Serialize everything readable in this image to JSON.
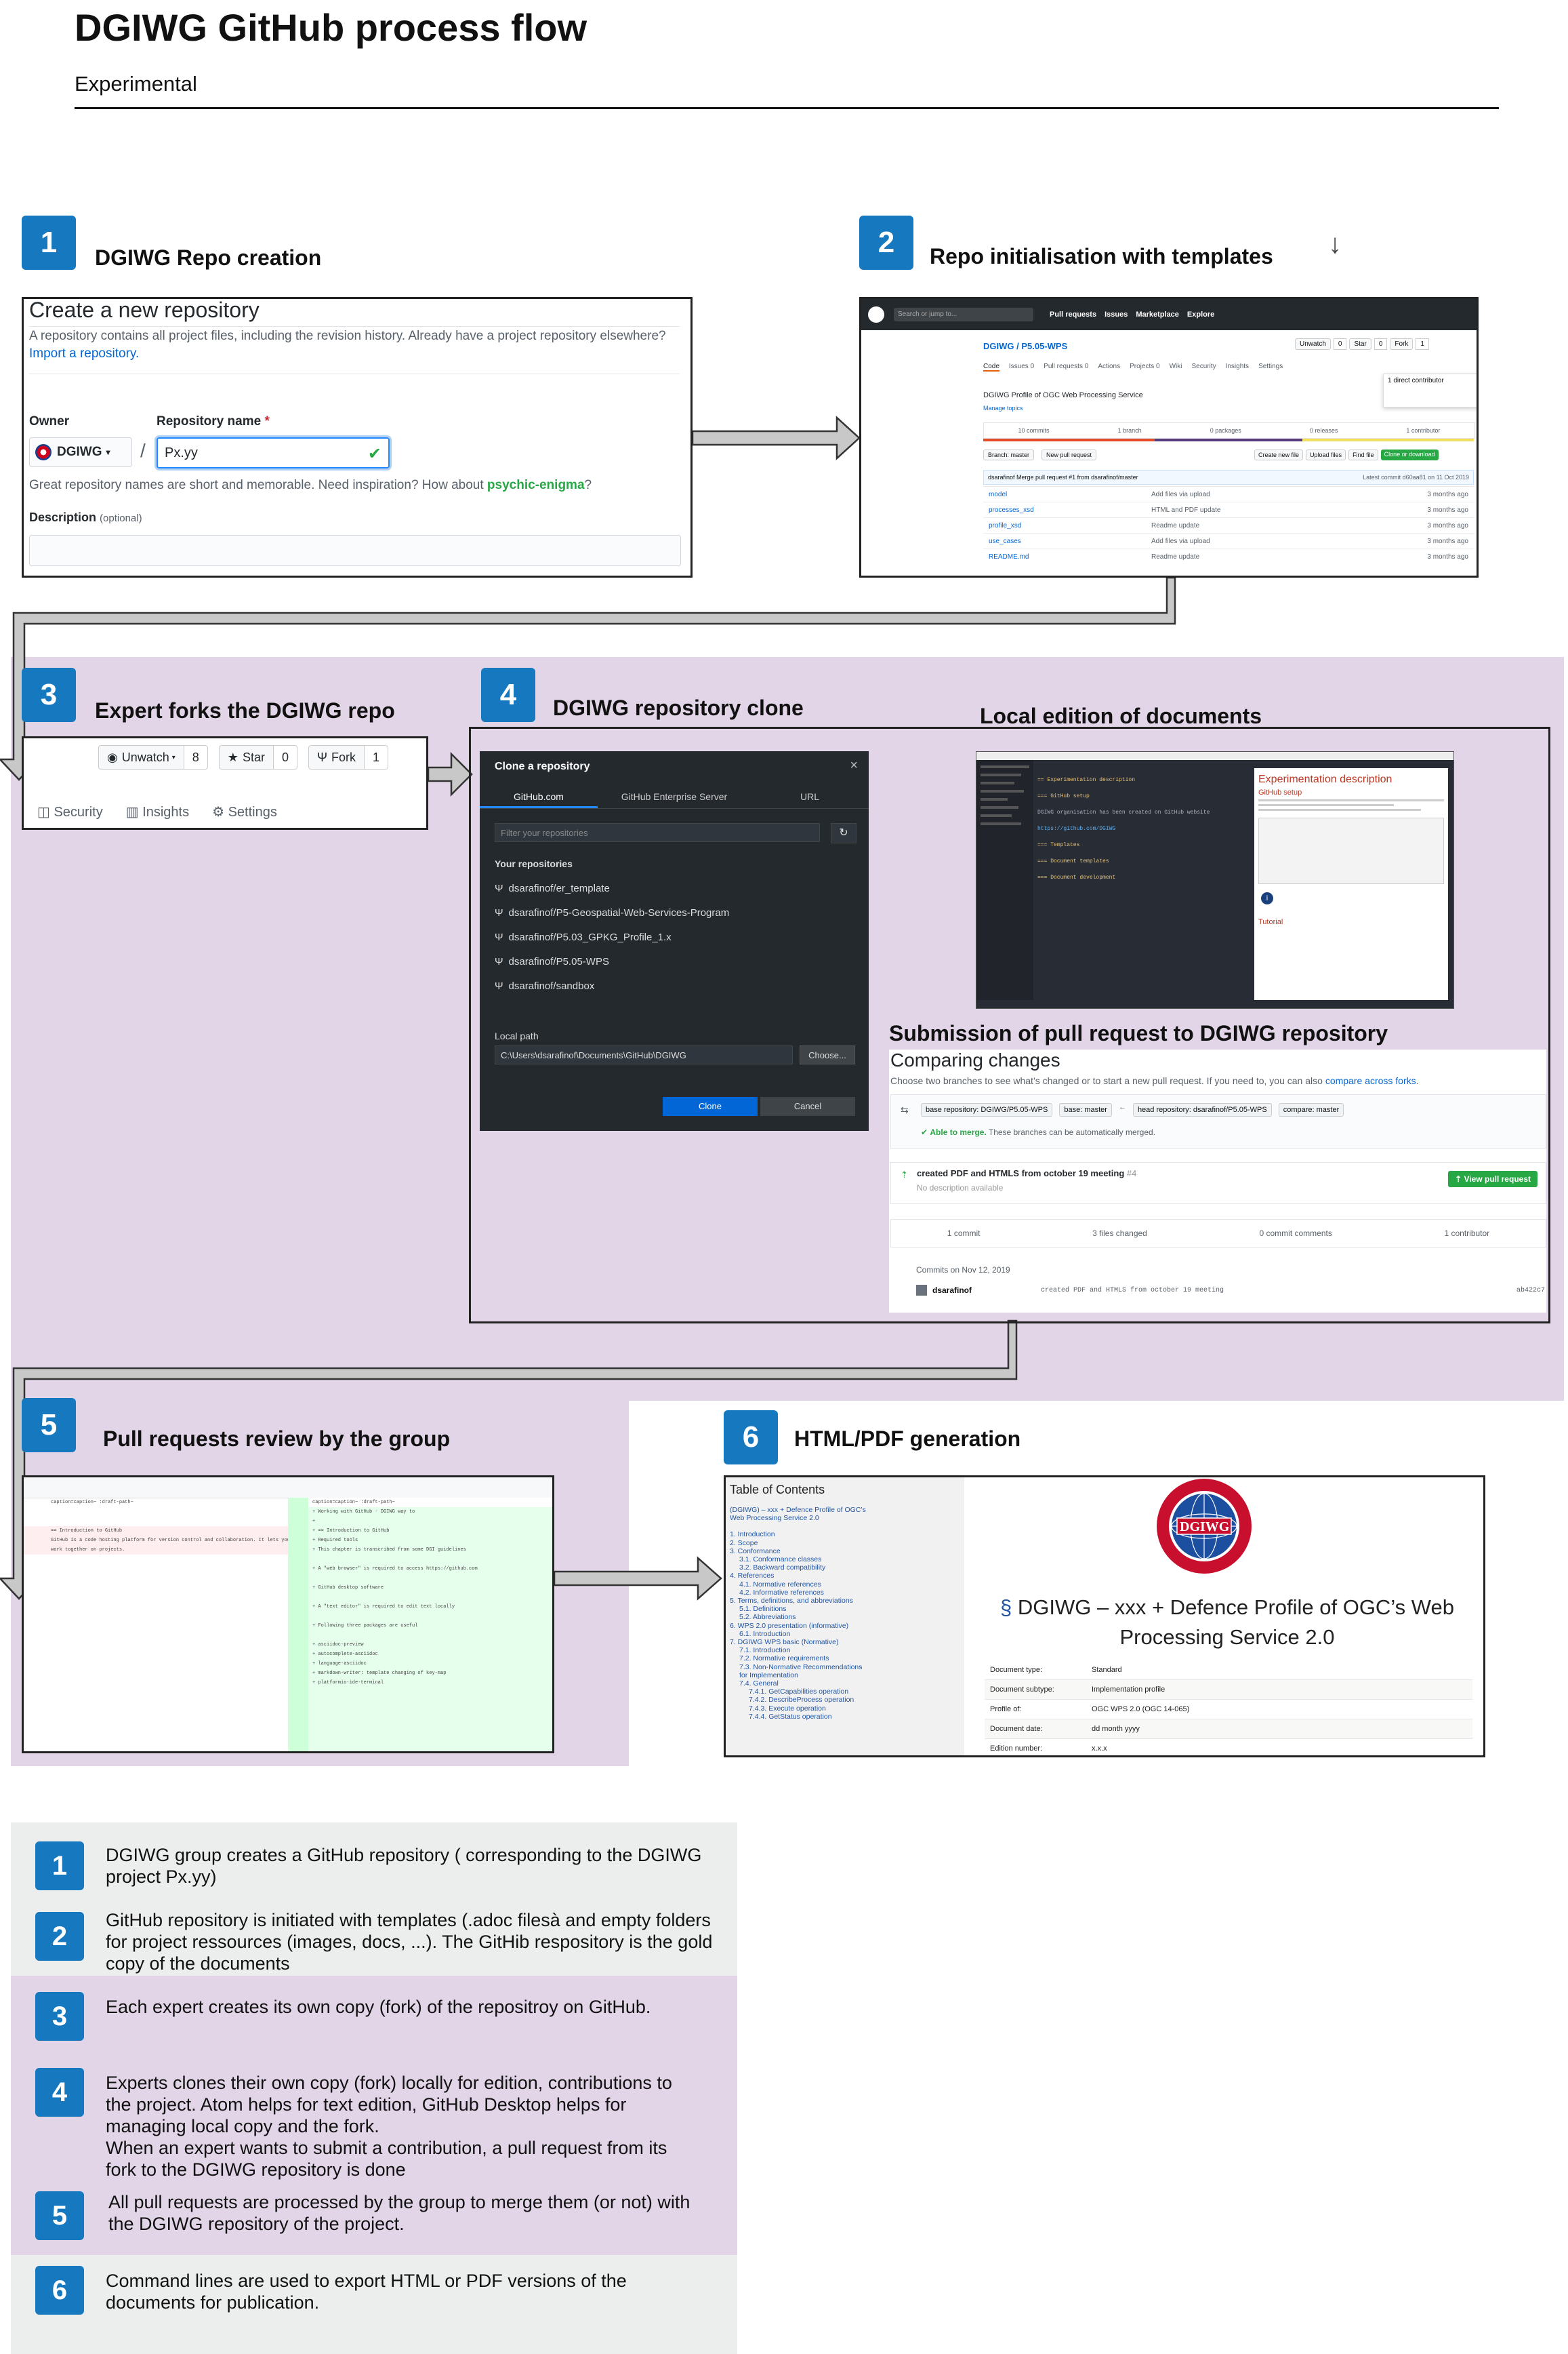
{
  "header": {
    "title": "DGIWG GitHub process flow",
    "subtitle": "Experimental"
  },
  "colors": {
    "badge": "#1679bf",
    "purple_band": "#e1d5e7",
    "grey_band": "#eceeed",
    "arrow": "#c8c8c8"
  },
  "steps": [
    {
      "num": "1",
      "title": "DGIWG Repo creation"
    },
    {
      "num": "2",
      "title": "Repo initialisation with templates"
    },
    {
      "num": "3",
      "title": "Expert forks the DGIWG repo"
    },
    {
      "num": "4",
      "title": "DGIWG repository clone"
    },
    {
      "num": "5",
      "title": "Pull requests review by the group"
    },
    {
      "num": "6",
      "title": "HTML/PDF generation"
    }
  ],
  "extra_titles": {
    "local_edition": "Local edition of documents",
    "submission": "Submission of pull request to DGIWG repository"
  },
  "create_repo": {
    "heading": "Create a new repository",
    "desc": "A repository contains all project files, including the revision history. Already have a project repository elsewhere?",
    "import_link": "Import a repository.",
    "owner_label": "Owner",
    "repo_label": "Repository name",
    "required_mark": "*",
    "owner_value": "DGIWG",
    "slash": "/",
    "repo_value": "Px.yy",
    "hint_prefix": "Great repository names are short and memorable. Need inspiration? How about",
    "hint_name": "psychic-enigma",
    "hint_suffix": "?",
    "description_label": "Description",
    "description_optional": "(optional)"
  },
  "repo_init": {
    "search": "Search or jump to...",
    "nav": [
      "Pull requests",
      "Issues",
      "Marketplace",
      "Explore"
    ],
    "repo_path": "DGIWG / P5.05-WPS",
    "tabs": [
      "Code",
      "Issues 0",
      "Pull requests 0",
      "Actions",
      "Projects 0",
      "Wiki",
      "Security",
      "Insights",
      "Settings"
    ],
    "description": "DGIWG Profile of OGC Web Processing Service",
    "manage_topics": "Manage topics",
    "stats": [
      "10 commits",
      "1 branch",
      "0 packages",
      "0 releases",
      "1 contributor"
    ],
    "branch": "Branch: master",
    "new_pr": "New pull request",
    "buttons": [
      "Create new file",
      "Upload files",
      "Find file",
      "Clone or download"
    ],
    "commit_msg": "dsarafinof Merge pull request #1 from dsarafinof/master",
    "latest_commit": "Latest commit d60aa81 on 11 Oct 2019",
    "files": [
      {
        "name": "model",
        "msg": "Add files via upload",
        "age": "3 months ago"
      },
      {
        "name": "processes_xsd",
        "msg": "HTML and PDF update",
        "age": "3 months ago"
      },
      {
        "name": "profile_xsd",
        "msg": "Readme update",
        "age": "3 months ago"
      },
      {
        "name": "use_cases",
        "msg": "Add files via upload",
        "age": "3 months ago"
      },
      {
        "name": "README.md",
        "msg": "Readme update",
        "age": "3 months ago"
      }
    ],
    "watch": "Unwatch",
    "watch_n": "0",
    "star": "Star",
    "star_n": "0",
    "fork": "Fork",
    "fork_n": "1",
    "popup": "1 direct contributor"
  },
  "fork_bar": {
    "unwatch": "Unwatch",
    "unwatch_n": "8",
    "star": "Star",
    "star_n": "0",
    "fork": "Fork",
    "fork_n": "1",
    "tabs": [
      "Security",
      "Insights",
      "Settings"
    ]
  },
  "clone_dialog": {
    "title": "Clone a repository",
    "close": "×",
    "tabs": [
      "GitHub.com",
      "GitHub Enterprise Server",
      "URL"
    ],
    "filter_placeholder": "Filter your repositories",
    "section": "Your repositories",
    "repos": [
      "dsarafinof/er_template",
      "dsarafinof/P5-Geospatial-Web-Services-Program",
      "dsarafinof/P5.03_GPKG_Profile_1.x",
      "dsarafinof/P5.05-WPS",
      "dsarafinof/sandbox"
    ],
    "local_path_label": "Local path",
    "local_path": "C:\\Users\\dsarafinof\\Documents\\GitHub\\DGIWG",
    "choose": "Choose...",
    "clone": "Clone",
    "cancel": "Cancel"
  },
  "atom": {
    "preview_title": "Experimentation description",
    "preview_sub": "GitHub setup",
    "preview_sub2": "Tutorial",
    "code_lines": [
      "== Experimentation description",
      "=== GitHub setup",
      "DGIWG organisation has been created on GitHub website",
      "https://github.com/DGIWG",
      "=== Templates",
      "=== Document templates",
      "=== Document development"
    ]
  },
  "compare": {
    "heading": "Comparing changes",
    "desc_prefix": "Choose two branches to see what’s changed or to start a new pull request. If you need to, you can also",
    "desc_link": "compare across forks",
    "desc_suffix": ".",
    "base_repo": "base repository: DGIWG/P5.05-WPS",
    "base": "base: master",
    "head_repo": "head repository: dsarafinof/P5.05-WPS",
    "compare": "compare: master",
    "able_bold": "Able to merge.",
    "able_rest": "These branches can be automatically merged.",
    "pr_title": "created PDF and HTMLS from october 19 meeting",
    "pr_num": "#4",
    "no_desc": "No description available",
    "view_pr": "View pull request",
    "stats": [
      "1 commit",
      "3 files changed",
      "0 commit comments",
      "1 contributor"
    ],
    "commits_on": "Commits on Nov 12, 2019",
    "author": "dsarafinof",
    "commit_msg": "created PDF and HTMLS from october 19 meeting",
    "sha": "ab422c7"
  },
  "html_doc": {
    "toc_title": "Table of Contents",
    "toc": [
      "(DGIWG) – xxx + Defence Profile of OGC’s",
      "Web Processing Service 2.0",
      "1. Introduction",
      "2. Scope",
      "3. Conformance",
      "3.1. Conformance classes",
      "3.2. Backward compatibility",
      "4. References",
      "4.1. Normative references",
      "4.2. Informative references",
      "5. Terms, definitions, and abbreviations",
      "5.1. Definitions",
      "5.2. Abbreviations",
      "6. WPS 2.0 presentation (informative)",
      "6.1. Introduction",
      "7. DGIWG WPS basic (Normative)",
      "7.1. Introduction",
      "7.2. Normative requirements",
      "7.3. Non-Normative Recommendations",
      "for Implementation",
      "7.4. General",
      "7.4.1. GetCapabilities operation",
      "7.4.2. DescribeProcess operation",
      "7.4.3. Execute operation",
      "7.4.4. GetStatus operation"
    ],
    "seal_name": "DGIWG",
    "seal_ring": "DEFENCE GEOSPATIAL INFORMATION WORKING GROUP",
    "section_mark": "§",
    "doc_title": "DGIWG – xxx + Defence Profile of OGC’s Web Processing Service 2.0",
    "meta": [
      {
        "k": "Document type:",
        "v": "Standard"
      },
      {
        "k": "Document subtype:",
        "v": "Implementation profile"
      },
      {
        "k": "Profile of:",
        "v": "OGC WPS 2.0 (OGC 14-065)"
      },
      {
        "k": "Document date:",
        "v": "dd month yyyy"
      },
      {
        "k": "Edition number:",
        "v": "x.x.x"
      }
    ]
  },
  "diff": {
    "left_lines": [
      "caption=caption~ :draft-path~",
      "",
      "== Introduction to GitHub",
      "GitHub is a code hosting platform for version control and collaboration. It lets you and others",
      "work together on projects."
    ],
    "right_lines": [
      "caption=caption~ :draft-path~",
      "+ Working with GitHub - DGIWG way to",
      "+",
      "+ == Introduction to GitHub",
      "+ Required tools",
      "+ This chapter is transcribed from some DGI guidelines",
      "+ A \"web browser\" is required to access https://github.com",
      "+ GitHub desktop software",
      "+ A \"text editor\" is required to edit text locally",
      "+ Following three packages are useful",
      "+ asciidoc-preview",
      "+ autocomplete-asciidoc",
      "+ language-asciidoc",
      "+ markdown-writer: template changing of key-map",
      "+ platformio-ide-terminal"
    ]
  },
  "legend": [
    {
      "num": "1",
      "text": "DGIWG group creates a GitHub repository ( corresponding to the DGIWG project Px.yy)"
    },
    {
      "num": "2",
      "text": "GitHub repository is initiated with templates (.adoc filesà and empty folders for project ressources (images, docs, ...). The GitHib respository is the gold copy of the documents"
    },
    {
      "num": "3",
      "text": "Each expert creates its own copy (fork) of the repositroy on GitHub."
    },
    {
      "num": "4",
      "text": "Experts clones their own copy (fork) locally for edition, contributions to the project. Atom helps for text edition, GitHub Desktop helps for managing local copy and the fork.\nWhen an expert wants to submit a contribution, a pull request from its fork to the DGIWG repository is done"
    },
    {
      "num": "5",
      "text": "All pull requests are processed by the group to merge them (or not) with the DGIWG repository of the project."
    },
    {
      "num": "6",
      "text": "Command lines are used to export HTML or PDF versions of the documents for publication."
    }
  ],
  "decor": {
    "small_arrow": "↓"
  }
}
